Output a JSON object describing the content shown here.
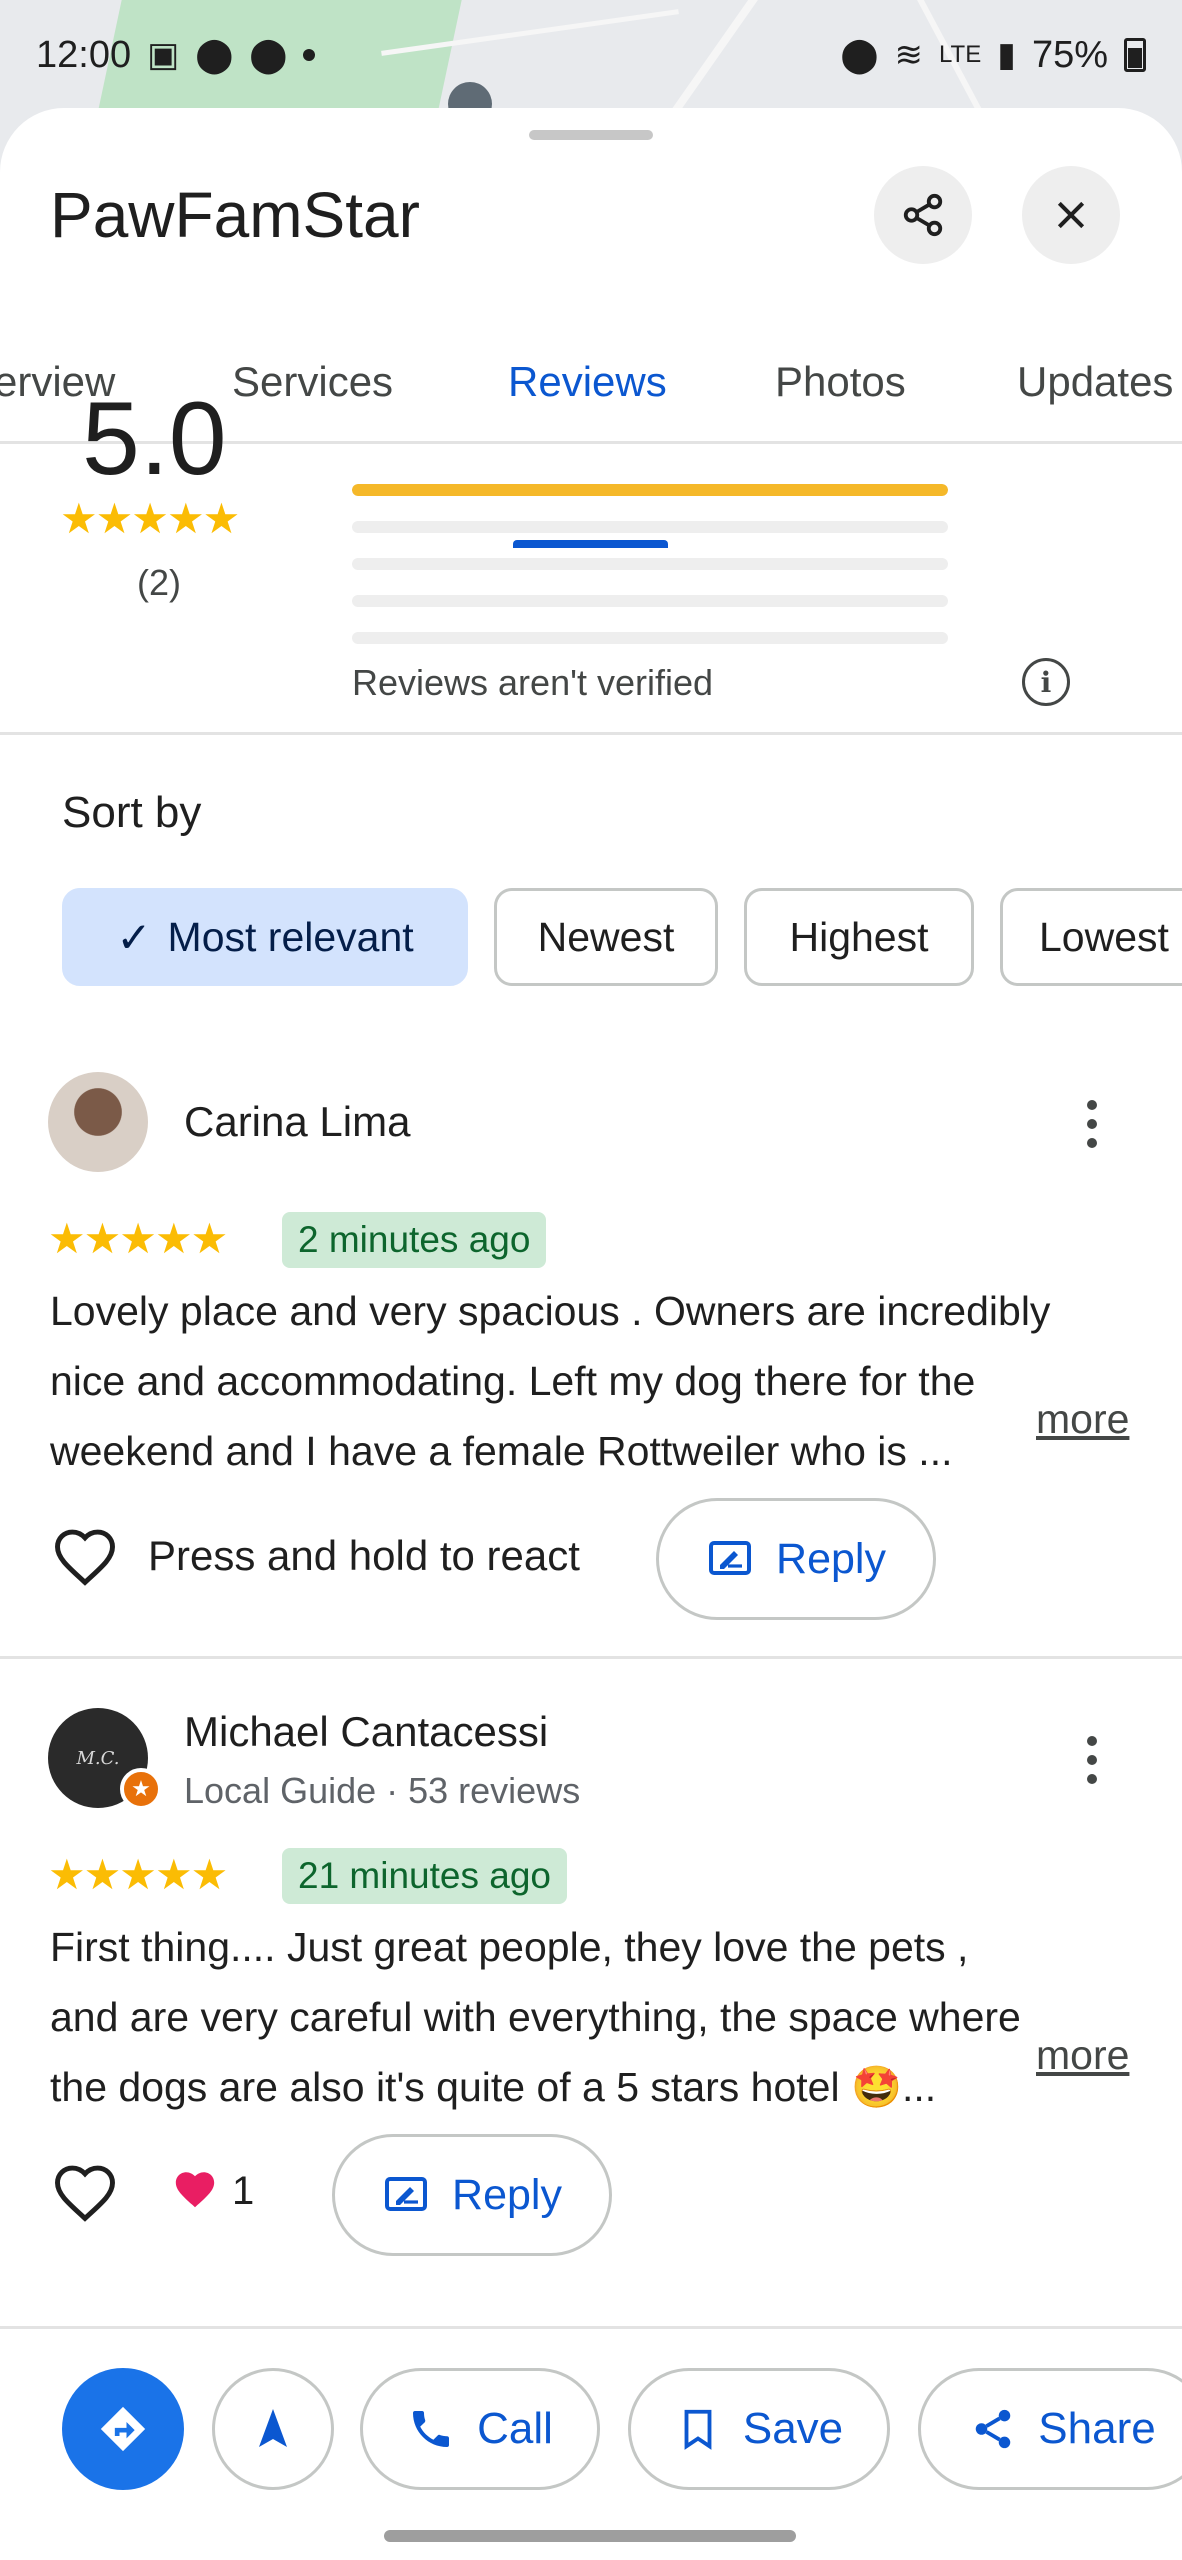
{
  "status_bar": {
    "time": "12:00",
    "battery": "75%",
    "network": "LTE"
  },
  "place": {
    "title": "PawFamStar"
  },
  "tabs": [
    {
      "label": "erview"
    },
    {
      "label": "Services"
    },
    {
      "label": "Reviews"
    },
    {
      "label": "Photos"
    },
    {
      "label": "Updates"
    }
  ],
  "summary": {
    "rating": "5.0",
    "stars": "★★★★★",
    "count": "(2)",
    "distribution": [
      1.0,
      0,
      0,
      0,
      0
    ],
    "verified_note": "Reviews aren't verified"
  },
  "sort": {
    "label": "Sort by",
    "options": [
      {
        "label": "Most relevant",
        "selected": true
      },
      {
        "label": "Newest"
      },
      {
        "label": "Highest"
      },
      {
        "label": "Lowest"
      }
    ]
  },
  "reviews": [
    {
      "name": "Carina Lima",
      "stars": "★★★★★",
      "time": "2 minutes ago",
      "lines": [
        "Lovely place and very spacious . Owners are incredibly",
        "nice and accommodating. Left my dog there for the",
        "weekend and I have a female Rottweiler who is ..."
      ],
      "more": "more",
      "react_text": "Press and hold to react",
      "reply": "Reply"
    },
    {
      "name": "Michael Cantacessi",
      "subtitle": "Local Guide · 53 reviews",
      "stars": "★★★★★",
      "time": "21 minutes ago",
      "lines": [
        "First thing.... Just great people, they love the pets ,",
        "and are very careful with everything, the space where",
        "the dogs are also it's quite of a 5 stars hotel 🤩..."
      ],
      "more": "more",
      "reaction_count": "1",
      "reply": "Reply"
    }
  ],
  "actions": {
    "call": "Call",
    "save": "Save",
    "share": "Share"
  },
  "colors": {
    "accent": "#0b57d0",
    "star": "#fbbc04",
    "time_badge_bg": "#ceead6",
    "chip_selected_bg": "#d3e3fd"
  }
}
